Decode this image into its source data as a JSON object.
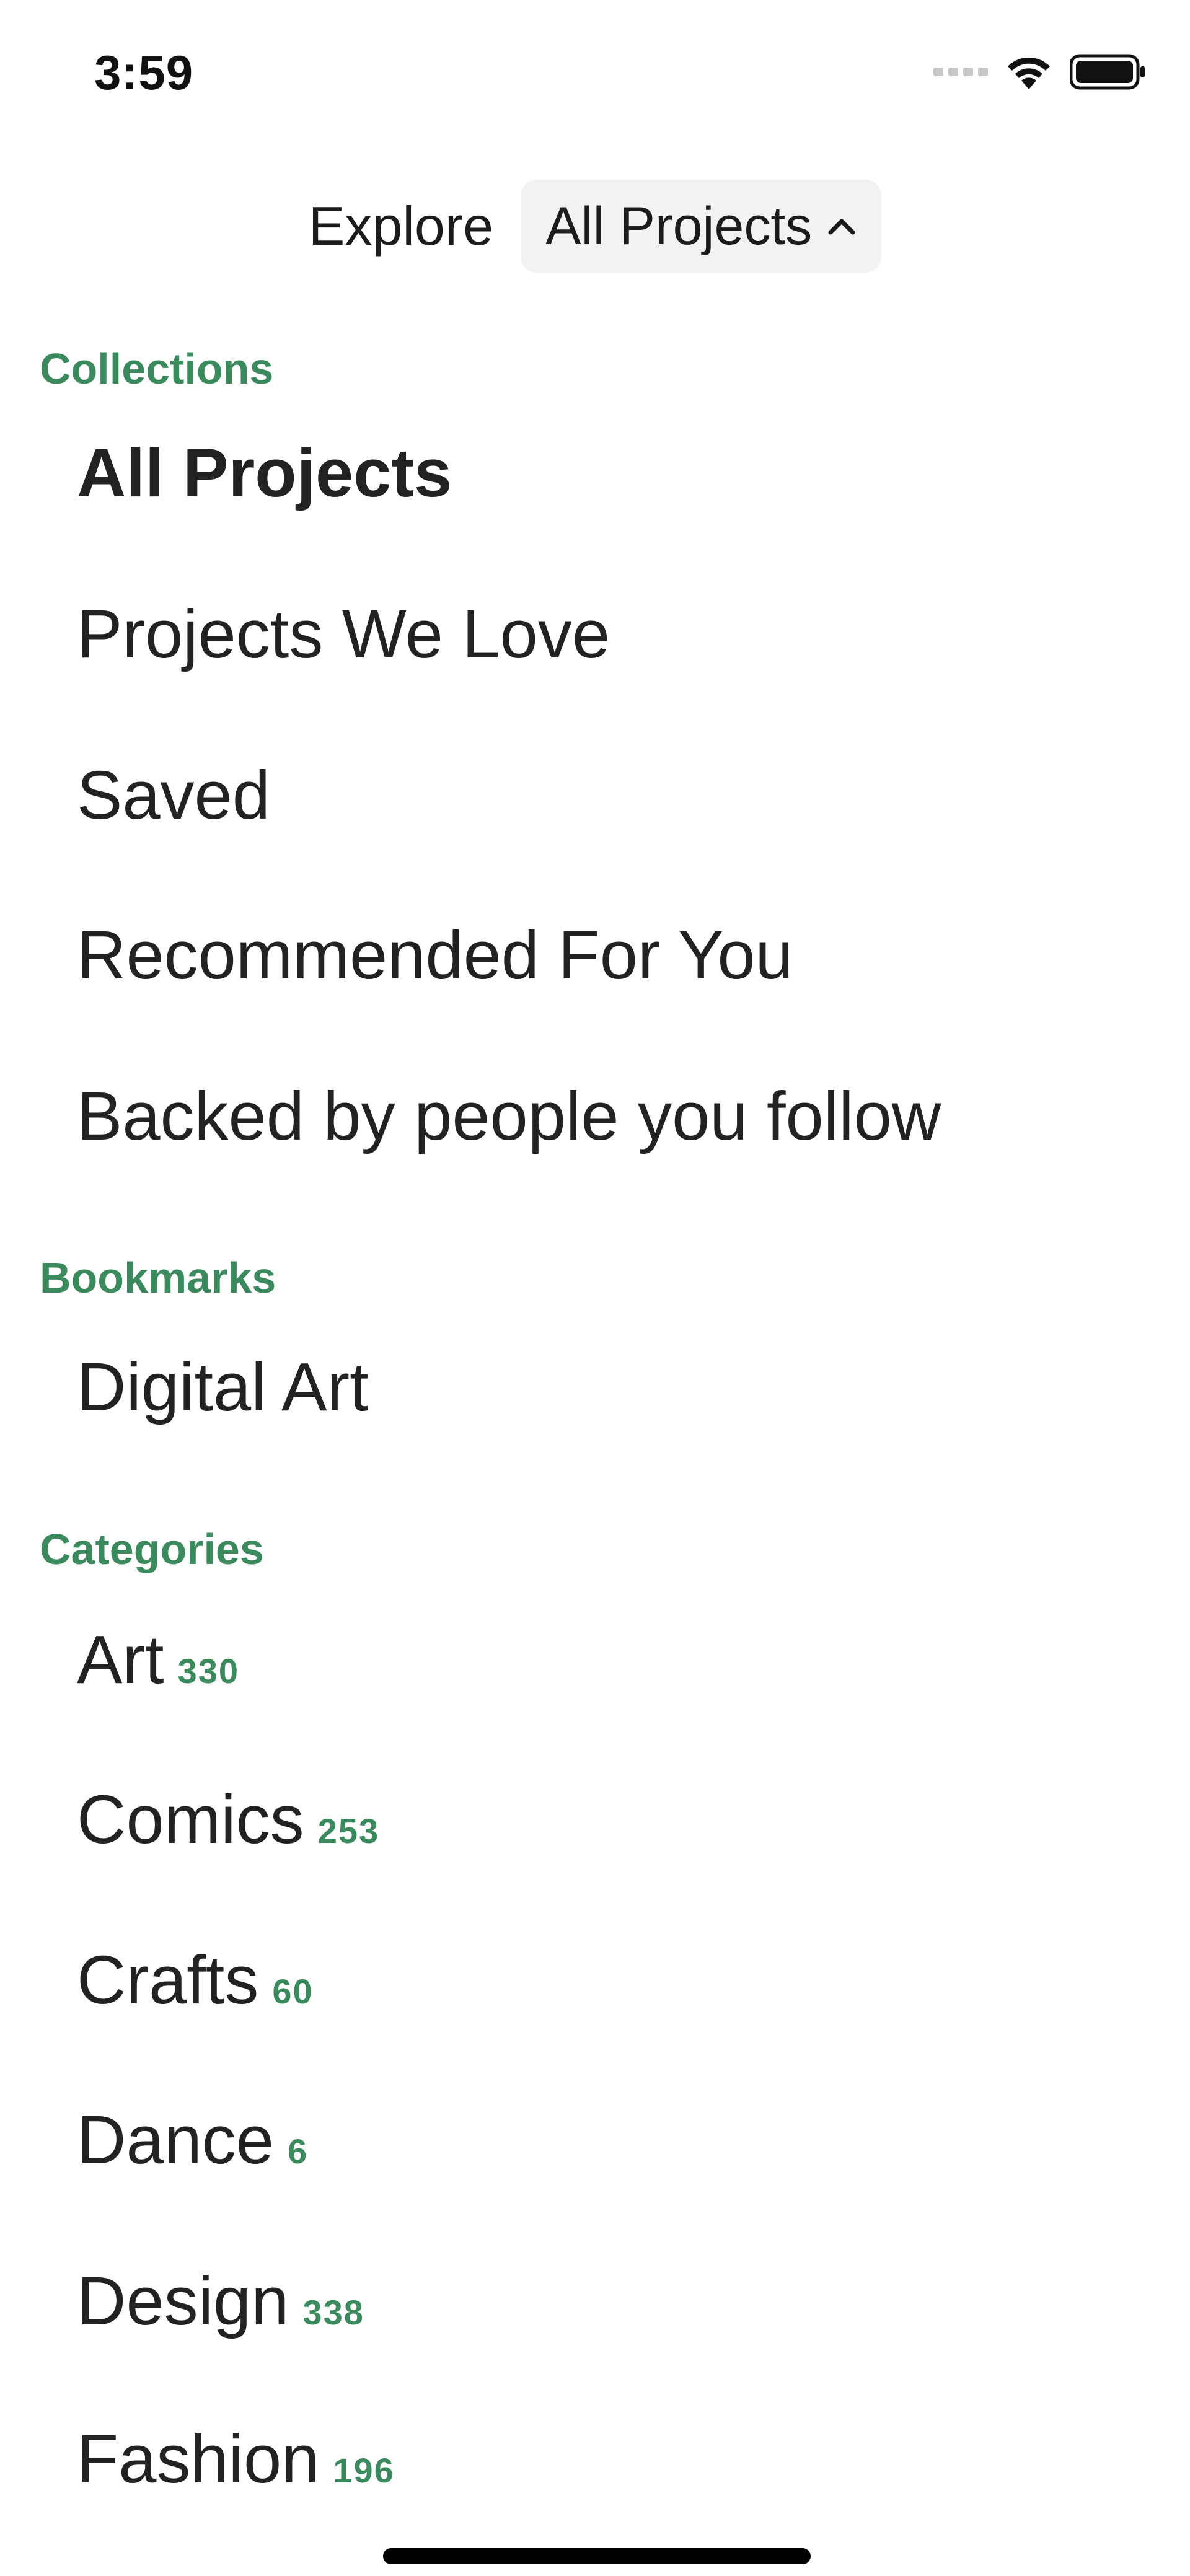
{
  "status_bar": {
    "time": "3:59"
  },
  "nav": {
    "title": "Explore",
    "picker_label": "All Projects"
  },
  "sections": {
    "collections": {
      "header": "Collections",
      "items": [
        {
          "label": "All Projects",
          "selected": true
        },
        {
          "label": "Projects We Love"
        },
        {
          "label": "Saved"
        },
        {
          "label": "Recommended For You"
        },
        {
          "label": "Backed by people you follow"
        }
      ]
    },
    "bookmarks": {
      "header": "Bookmarks",
      "items": [
        {
          "label": "Digital Art"
        }
      ]
    },
    "categories": {
      "header": "Categories",
      "items": [
        {
          "label": "Art",
          "count": "330"
        },
        {
          "label": "Comics",
          "count": "253"
        },
        {
          "label": "Crafts",
          "count": "60"
        },
        {
          "label": "Dance",
          "count": "6"
        },
        {
          "label": "Design",
          "count": "338"
        },
        {
          "label": "Fashion",
          "count": "196"
        }
      ]
    }
  },
  "colors": {
    "accent": "#3b8a5e",
    "text": "#222222",
    "picker_bg": "#f2f2f2"
  }
}
